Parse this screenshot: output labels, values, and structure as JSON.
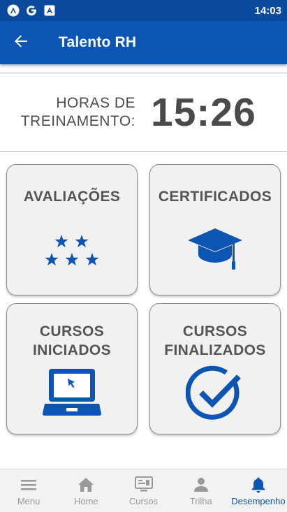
{
  "status_bar": {
    "time": "14:03",
    "icons": [
      "app-icon-a",
      "google-g-icon",
      "app-icon-square-a"
    ]
  },
  "app_bar": {
    "title": "Talento RH",
    "back_icon": "arrow-left-icon"
  },
  "hours": {
    "label_line1": "HORAS DE",
    "label_line2": "TREINAMENTO:",
    "value": "15:26"
  },
  "cards": [
    {
      "title_line1": "AVALIAÇÕES",
      "icon": "stars-icon"
    },
    {
      "title_line1": "CERTIFICADOS",
      "icon": "graduation-cap-icon"
    },
    {
      "title_line1": "CURSOS",
      "title_line2": "INICIADOS",
      "icon": "laptop-cursor-icon"
    },
    {
      "title_line1": "CURSOS",
      "title_line2": "FINALIZADOS",
      "icon": "check-circle-icon"
    }
  ],
  "bottom_nav": {
    "items": [
      {
        "label": "Menu",
        "icon": "hamburger-menu-icon"
      },
      {
        "label": "Home",
        "icon": "home-icon"
      },
      {
        "label": "Cursos",
        "icon": "presentation-icon"
      },
      {
        "label": "Trilha",
        "icon": "person-icon"
      },
      {
        "label": "Desempenho",
        "icon": "bell-icon",
        "active": true
      }
    ]
  },
  "colors": {
    "status_bar": "#0a4a9c",
    "app_bar": "#0d55b3",
    "icon_blue": "#0d55b3",
    "nav_inactive": "#9a9a9a",
    "card_bg": "#f1f1f1"
  }
}
